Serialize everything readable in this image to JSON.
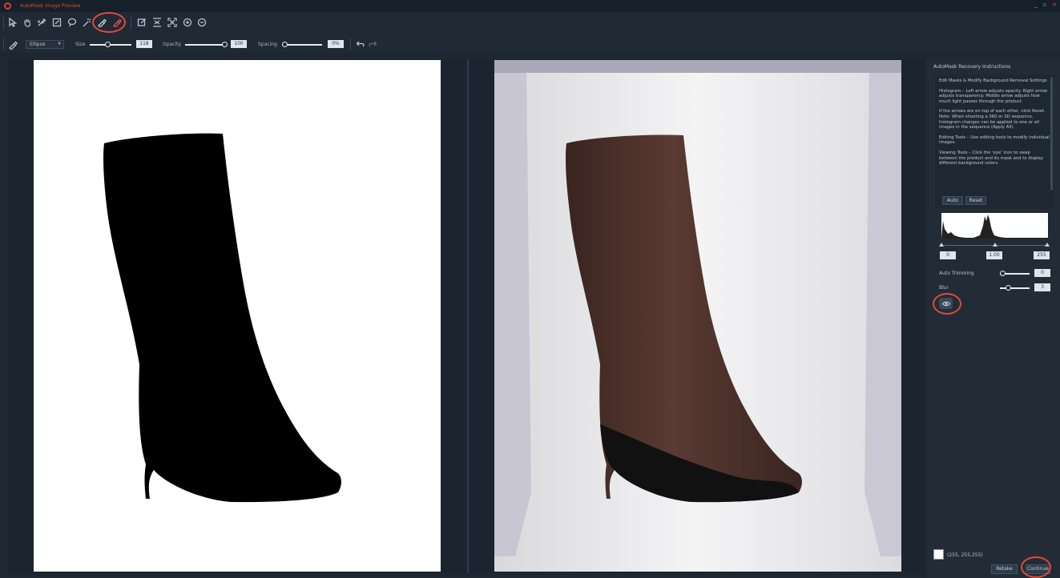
{
  "window": {
    "title": "AutoMask Image Preview",
    "controls": [
      "_",
      "▫",
      "✕"
    ]
  },
  "toolbar": {
    "tools": [
      {
        "icon": "select-arrow-icon"
      },
      {
        "icon": "hand-pan-icon"
      },
      {
        "icon": "brush-add-icon"
      },
      {
        "icon": "brush-edit-icon"
      },
      {
        "icon": "lasso-icon"
      },
      {
        "icon": "magic-wand-icon"
      },
      {
        "icon": "recovery-brush-icon"
      },
      {
        "icon": "eraser-brush-icon"
      },
      {
        "icon": "fit-edit-icon"
      },
      {
        "icon": "fit-width-icon"
      },
      {
        "icon": "fit-screen-icon"
      },
      {
        "icon": "zoom-in-icon"
      },
      {
        "icon": "zoom-out-icon"
      }
    ]
  },
  "brush_options": {
    "shape": "Ellipse",
    "size_label": "Size",
    "size_value": "118",
    "size_level": 0.45,
    "opacity_label": "Opacity",
    "opacity_value": "100",
    "opacity_level": 1.0,
    "spacing_label": "Spacing",
    "spacing_value": "0%",
    "spacing_level": 0.0
  },
  "side_panel": {
    "title": "AutoMask Recovery Instructions",
    "instructions": [
      "Edit Masks & Modify Background Removal Settings",
      "Histogram – Left arrow adjusts opacity. Right arrow adjusts transparency. Middle arrow adjusts how much light passes through the product.",
      "If the arrows are on top of each other, click Reset. Note: When shooting a 360 or 3D sequence, histogram changes can be applied to one or all images in the sequence (Apply All).",
      "Editing Tools – Use editing tools to modify individual images.",
      "Viewing Tools – Click the 'eye' icon to swap between the product and its mask and to display different background colors."
    ],
    "auto_button": "Auto",
    "reset_button": "Reset",
    "histogram": {
      "low": "0",
      "mid": "1.00",
      "high": "255"
    },
    "auto_trimming_label": "Auto Trimming",
    "auto_trimming_value": "0",
    "auto_trimming_level": 0.0,
    "blur_label": "Blur",
    "blur_value": "3",
    "blur_level": 0.3,
    "background_color": "#ffffff",
    "background_color_text": "(255, 255,255)",
    "retake_button": "Retake",
    "continue_button": "Continue"
  },
  "colors": {
    "accent": "#e04a38",
    "panel": "#222c37",
    "boot_brown": "#4a302b"
  }
}
